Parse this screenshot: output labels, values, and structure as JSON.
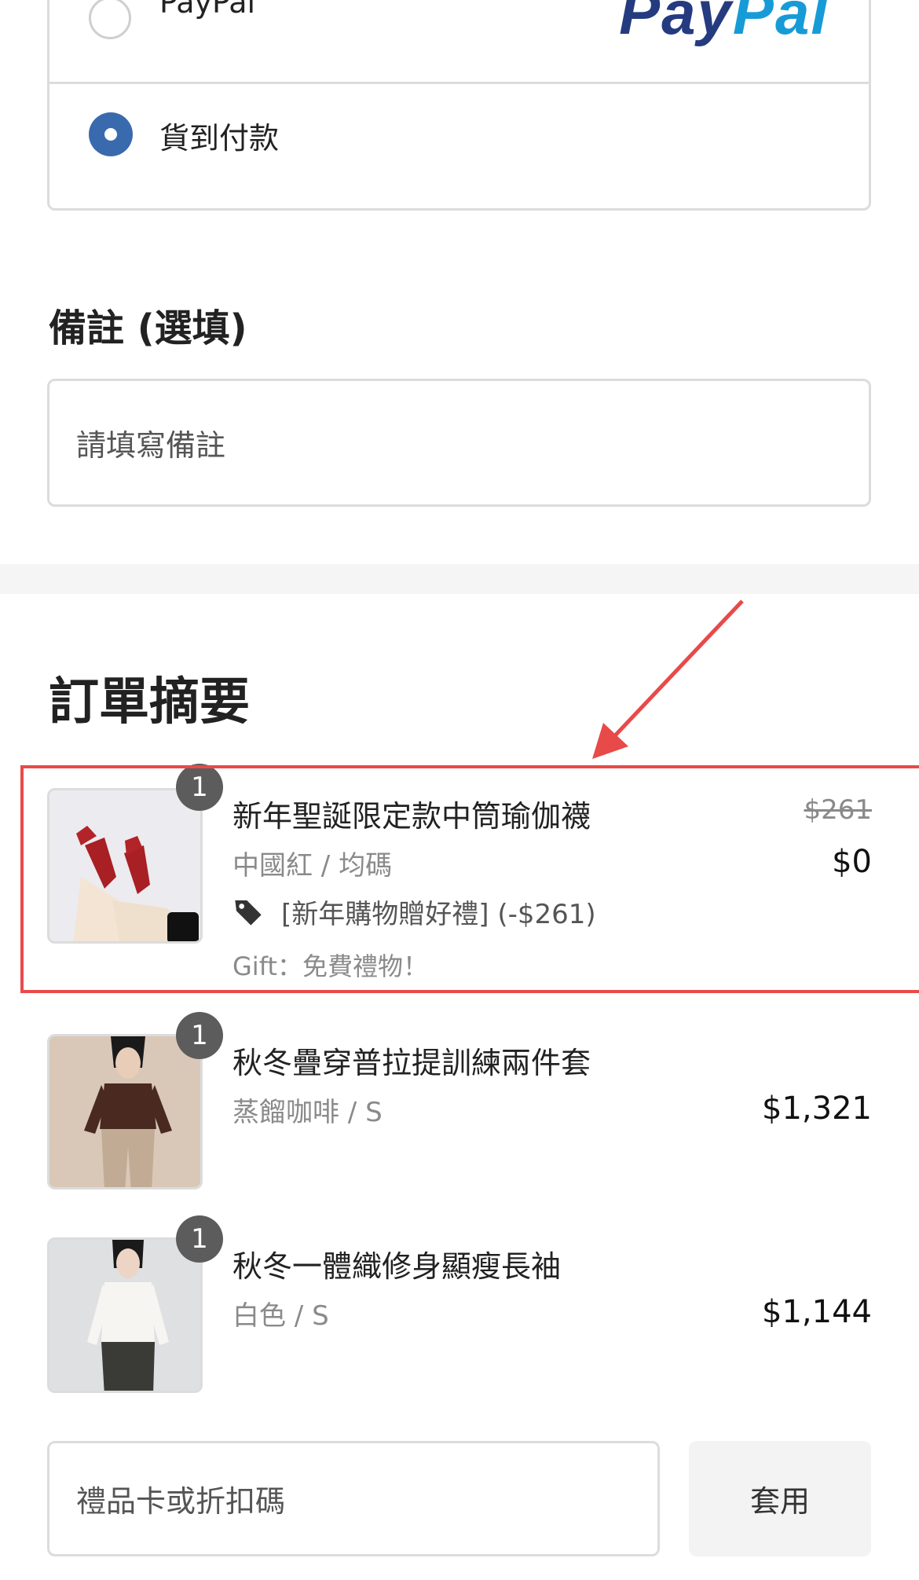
{
  "payment": {
    "option_paypal_label": "PayPal",
    "paypal_logo_pay": "Pay",
    "paypal_logo_pal": "Pal",
    "option_cod_label": "貨到付款"
  },
  "notes": {
    "title": "備註 (選填)",
    "placeholder": "請填寫備註"
  },
  "summary": {
    "title": "訂單摘要",
    "items": [
      {
        "qty": "1",
        "name": "新年聖誕限定款中筒瑜伽襪",
        "variant": "中國紅 / 均碼",
        "original_price": "$261",
        "price": "$0",
        "discount": "[新年購物贈好禮] (-$261)",
        "gift": "Gift：免費禮物！"
      },
      {
        "qty": "1",
        "name": "秋冬疊穿普拉提訓練兩件套",
        "variant": "蒸餾咖啡 / S",
        "price": "$1,321"
      },
      {
        "qty": "1",
        "name": "秋冬一體織修身顯瘦長袖",
        "variant": "白色 / S",
        "price": "$1,144"
      }
    ]
  },
  "discount_code": {
    "placeholder": "禮品卡或折扣碼",
    "apply_label": "套用"
  },
  "colors": {
    "accent": "#3a6aae",
    "highlight": "#e84a4a",
    "badge": "#5c5c5c"
  }
}
